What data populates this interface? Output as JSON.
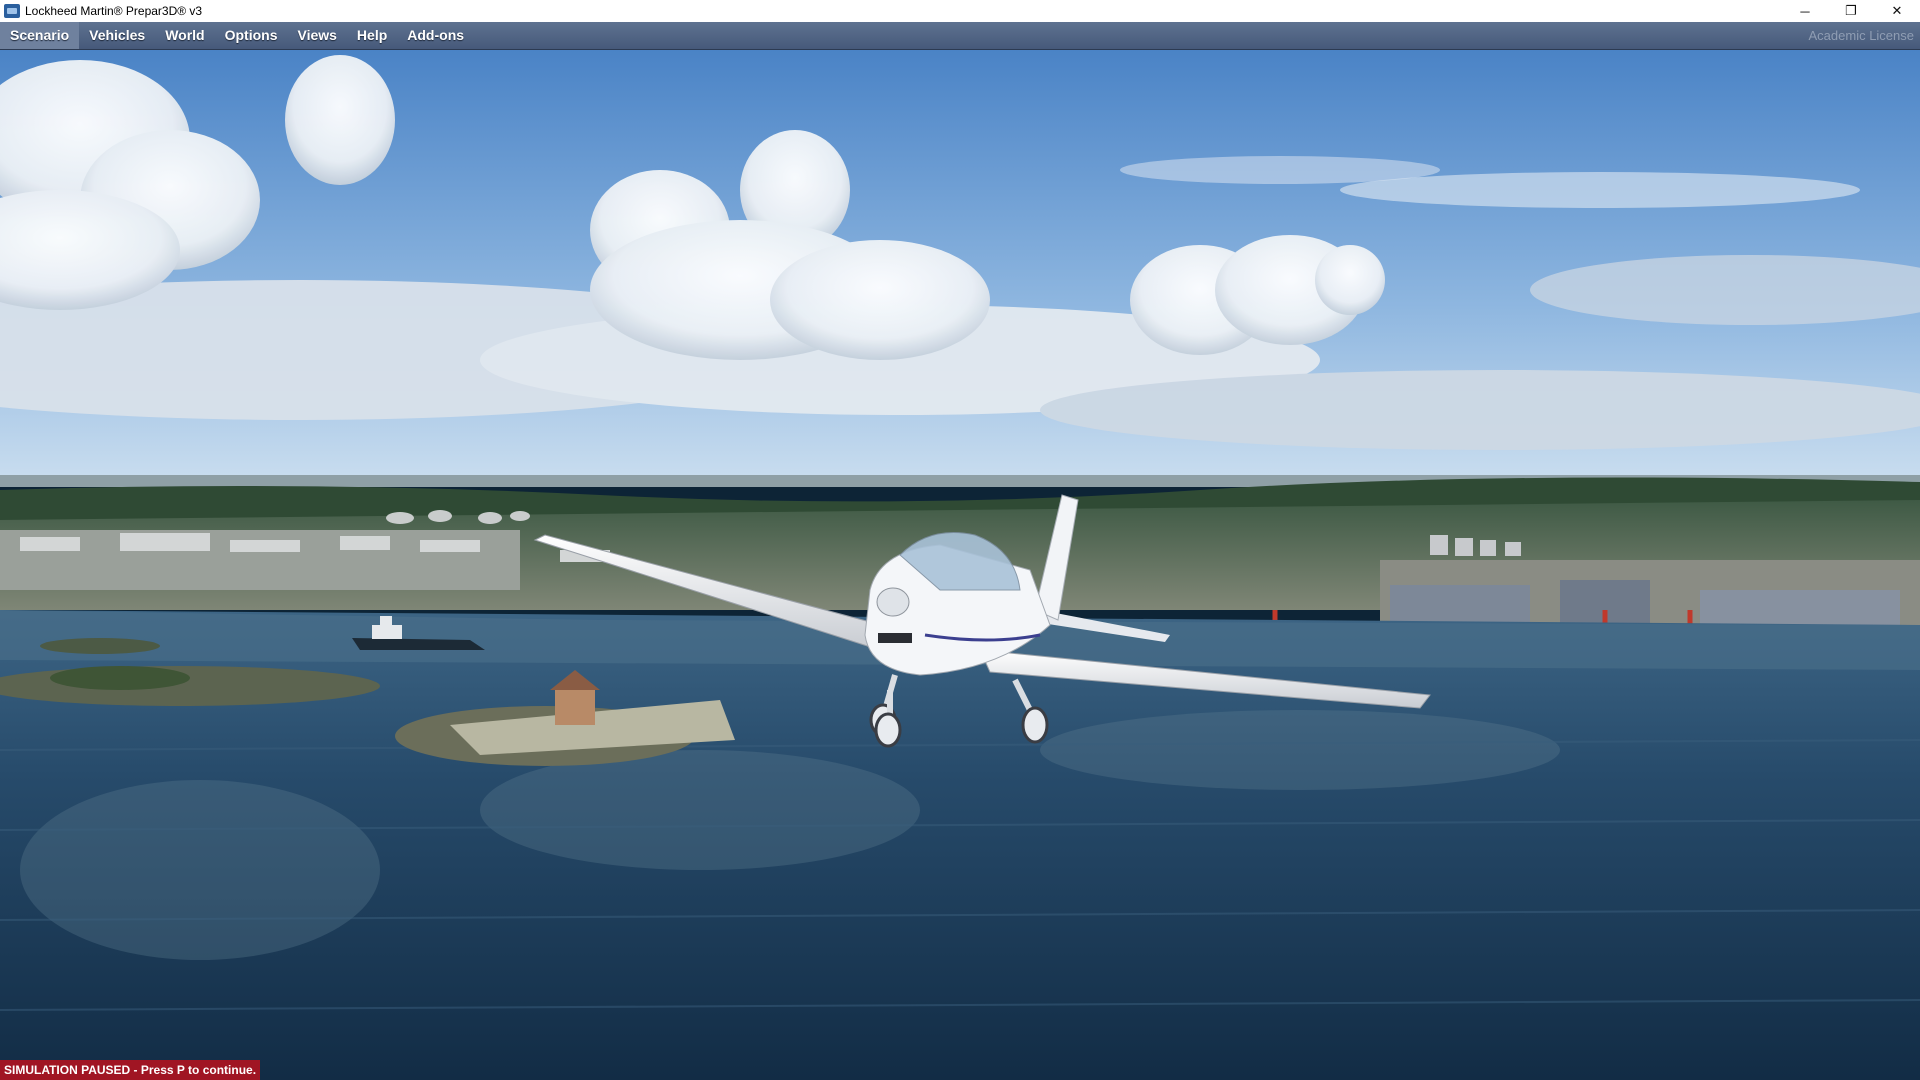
{
  "window": {
    "title": "Lockheed Martin® Prepar3D® v3",
    "controls": {
      "minimize": "─",
      "restore": "❐",
      "close": "✕"
    }
  },
  "menu": {
    "items": [
      {
        "label": "Scenario"
      },
      {
        "label": "Vehicles"
      },
      {
        "label": "World"
      },
      {
        "label": "Options"
      },
      {
        "label": "Views"
      },
      {
        "label": "Help"
      },
      {
        "label": "Add-ons"
      }
    ],
    "license": "Academic License"
  },
  "status": {
    "message": "SIMULATION PAUSED - Press P to continue."
  },
  "colors": {
    "menubar": "#52668a",
    "paused_badge": "#a01523",
    "sky_top": "#4f86c9",
    "water": "#1d3f5c"
  },
  "icons": {
    "app": "prepar3d-app-icon",
    "minimize": "minimize-icon",
    "restore": "restore-icon",
    "close": "close-icon"
  }
}
